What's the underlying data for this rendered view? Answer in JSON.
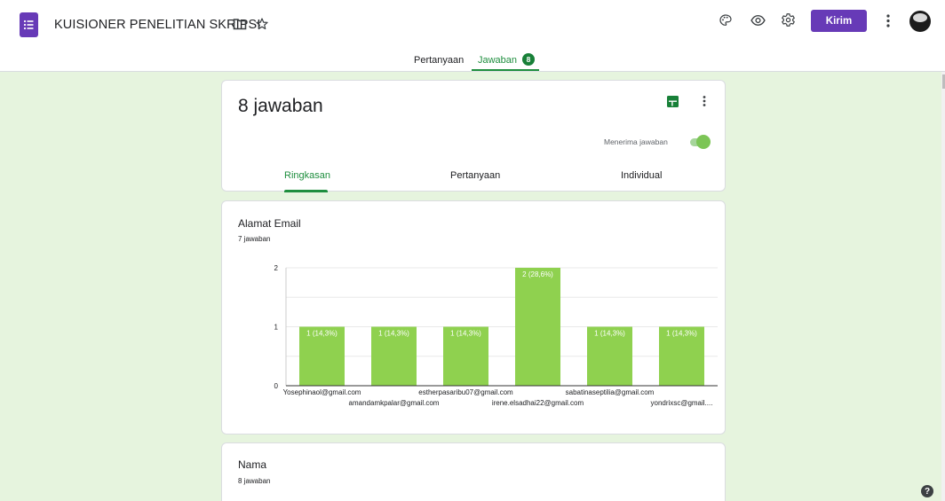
{
  "header": {
    "title": "KUISIONER PENELITIAN SKRIPSI",
    "send_label": "Kirim",
    "icons": [
      "forms-icon",
      "folder-icon",
      "star-icon",
      "palette-icon",
      "eye-icon",
      "gear-icon",
      "more-vert-icon",
      "avatar"
    ],
    "accent_color": "#673ab7"
  },
  "tabs": {
    "questions": "Pertanyaan",
    "responses": "Jawaban",
    "responses_count": "8",
    "active_color": "#1e8e3e"
  },
  "summary_card": {
    "title": "8 jawaban",
    "accepting_label": "Menerima jawaban",
    "accepting": true,
    "subtabs": [
      "Ringkasan",
      "Pertanyaan",
      "Individual"
    ],
    "active_subtab": "Ringkasan"
  },
  "email_card": {
    "title": "Alamat Email",
    "count_label": "7 jawaban"
  },
  "name_card": {
    "title": "Nama",
    "count_label": "8 jawaban"
  },
  "chart_data": {
    "type": "bar",
    "categories": [
      "Yosephinaol@gmail.com",
      "amandamkpalar@gmail.com",
      "estherpasaribu07@gmail.com",
      "irene.elsadhai22@gmail.com",
      "sabatinaseptilia@gmail.com",
      "yondrixsc@gmail...."
    ],
    "values": [
      1,
      1,
      1,
      2,
      1,
      1
    ],
    "data_labels": [
      "1 (14,3%)",
      "1 (14,3%)",
      "1 (14,3%)",
      "2 (28,6%)",
      "1 (14,3%)",
      "1 (14,3%)"
    ],
    "yticks": [
      "0",
      "1",
      "2"
    ],
    "ylim": [
      0,
      2
    ],
    "grid": true,
    "bar_color": "#8fd14f"
  }
}
